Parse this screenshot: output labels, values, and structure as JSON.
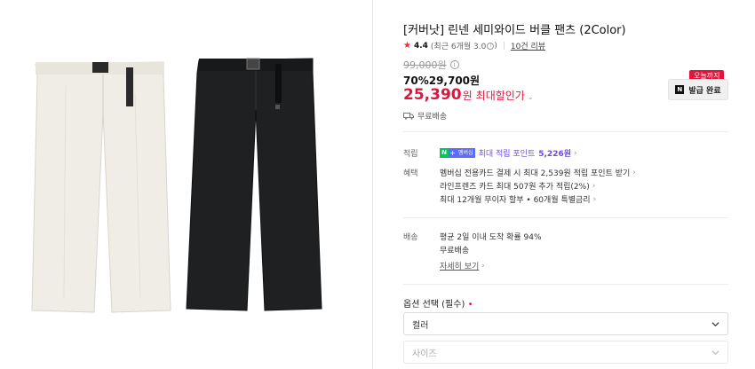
{
  "product": {
    "title": "[커버낫] 린넨 세미와이드 버클 팬츠 (2Color)",
    "rating": {
      "score": "4.4",
      "recent": "(최근 6개월 3.0",
      "recent_close": ")",
      "reviews": "10건 리뷰"
    },
    "original_price": "99,000원",
    "discount_line": "70%29,700원",
    "final_price": "25,390",
    "final_unit": "원",
    "max_discount_label": "최대할인가",
    "shipping_short": "무료배송"
  },
  "coupon": {
    "badge": "오늘까지",
    "label": "발급 완료",
    "logo": "N"
  },
  "benefits": {
    "points_label": "적립",
    "points_badge_n": "N",
    "points_badge_plus": "+",
    "points_badge_member": "멤버십",
    "points_text": "최대 적립 포인트",
    "points_value": "5,226원",
    "perks_label": "혜택",
    "perks": [
      "멤버십 전용카드 결제 시 최대 2,539원 적립 포인트 받기",
      "라인프렌즈 카드 최대 507원 추가 적립(2%)",
      "최대 12개월 무이자 할부 • 60개월 특별금리"
    ]
  },
  "delivery": {
    "label": "배송",
    "estimate": "평균 2일 이내 도착 확률 94%",
    "fee": "무료배송",
    "details_link": "자세히 보기"
  },
  "options": {
    "label": "옵션 선택 (필수)",
    "required_mark": "•",
    "color_placeholder": "컬러",
    "size_placeholder": "사이즈"
  },
  "colors": {
    "accent_red": "#e0143c",
    "rating_star": "#ee2a35",
    "naver_green": "#03c75a",
    "membership_purple": "#6e4bd8",
    "pants_ivory": "#efede6",
    "pants_black": "#1f2022"
  }
}
